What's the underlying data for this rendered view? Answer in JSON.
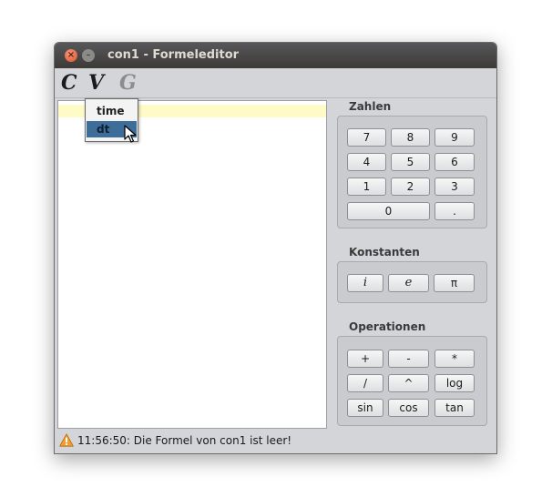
{
  "window": {
    "title": "con1 - Formeleditor"
  },
  "toolbar": {
    "c_label": "C",
    "v_label": "V",
    "g_label": "G"
  },
  "popup": {
    "items": [
      "time",
      "dt"
    ],
    "selected": "dt"
  },
  "zahlen": {
    "title": "Zahlen",
    "keys": [
      "7",
      "8",
      "9",
      "4",
      "5",
      "6",
      "1",
      "2",
      "3",
      "0",
      "."
    ]
  },
  "konstanten": {
    "title": "Konstanten",
    "keys": [
      "i",
      "e",
      "π"
    ]
  },
  "operationen": {
    "title": "Operationen",
    "keys": [
      "+",
      "-",
      "*",
      "/",
      "^",
      "log",
      "sin",
      "cos",
      "tan"
    ]
  },
  "status": {
    "icon": "warning-icon",
    "text": "11:56:50: Die Formel von con1 ist leer!"
  },
  "colors": {
    "highlight_line": "#fffbc6",
    "selected_item": "#3d6d99",
    "warning": "#f0a030"
  }
}
